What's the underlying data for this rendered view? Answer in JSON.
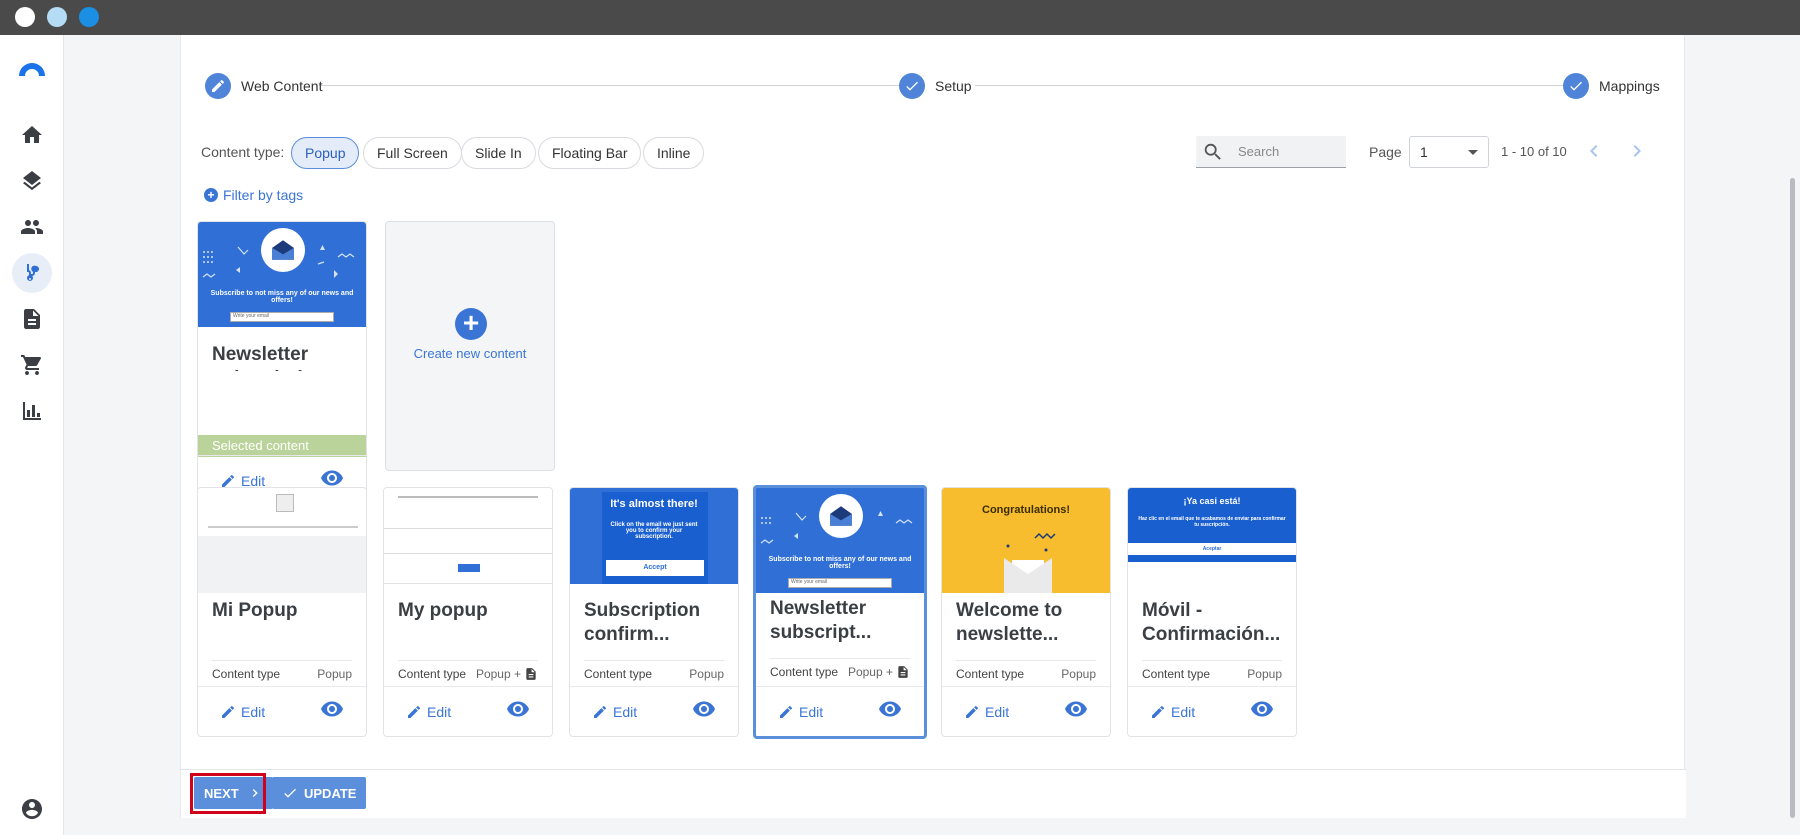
{
  "window": {
    "dots": [
      "#ffffff",
      "#b5dcf5",
      "#1a8fe3"
    ]
  },
  "sidebar": {
    "logo": "brand-logo",
    "items": [
      {
        "icon": "home-icon"
      },
      {
        "icon": "layers-icon"
      },
      {
        "icon": "people-icon"
      },
      {
        "icon": "flow-icon",
        "active": true
      },
      {
        "icon": "document-icon"
      },
      {
        "icon": "cart-icon"
      },
      {
        "icon": "bar-chart-icon"
      }
    ],
    "account": "account-icon"
  },
  "stepper": {
    "steps": [
      {
        "label": "Web Content",
        "icon": "pencil-icon"
      },
      {
        "label": "Setup",
        "icon": "check-icon"
      },
      {
        "label": "Mappings",
        "icon": "check-icon"
      }
    ]
  },
  "filters": {
    "content_type_label": "Content type:",
    "chips": [
      "Popup",
      "Full Screen",
      "Slide In",
      "Floating Bar",
      "Inline"
    ],
    "selected_chip": "Popup",
    "filter_by_tags": "Filter by tags"
  },
  "search": {
    "placeholder": "Search"
  },
  "pager": {
    "label": "Page",
    "value": "1",
    "range": "1 - 10 of 10"
  },
  "selected_card": {
    "title": "Newsletter subscription",
    "selected_label": "Selected content",
    "thumb_text": "Subscribe to not miss any of our news and offers!",
    "thumb_input": "Write your email",
    "edit": "Edit"
  },
  "create": {
    "label": "Create new content"
  },
  "cards": [
    {
      "title": "Mi Popup",
      "type_label": "Content type",
      "type_value": "Popup",
      "doc": false,
      "edit": "Edit"
    },
    {
      "title": "My popup",
      "type_label": "Content type",
      "type_value": "Popup +",
      "doc": true,
      "edit": "Edit"
    },
    {
      "title": "Subscription confirm...",
      "type_label": "Content type",
      "type_value": "Popup",
      "doc": false,
      "edit": "Edit",
      "thumb_heading": "It's almost there!",
      "thumb_body": "Click on the email we just sent you to confirm your subscription.",
      "thumb_button": "Accept"
    },
    {
      "title": "Newsletter subscript...",
      "type_label": "Content type",
      "type_value": "Popup +",
      "doc": true,
      "edit": "Edit",
      "thumb_text": "Subscribe to not miss any of our news and offers!",
      "thumb_input": "Write your email"
    },
    {
      "title": "Welcome to newslette...",
      "type_label": "Content type",
      "type_value": "Popup",
      "doc": false,
      "edit": "Edit",
      "thumb_heading": "Congratulations!"
    },
    {
      "title": "Móvil - Confirmación...",
      "type_label": "Content type",
      "type_value": "Popup",
      "doc": false,
      "edit": "Edit",
      "thumb_heading": "¡Ya casi está!",
      "thumb_body": "Haz clic en el email que te acabamos de enviar para confirmar tu suscripción.",
      "thumb_button": "Aceptar"
    }
  ],
  "actions": {
    "next": "NEXT",
    "update": "UPDATE"
  },
  "colors": {
    "accent": "#5b8fdc",
    "selected_green": "#b9d39a",
    "highlight_red": "#d0021b",
    "thumb_blue": "#2f6fd6",
    "thumb_yellow": "#f7bd2e"
  }
}
